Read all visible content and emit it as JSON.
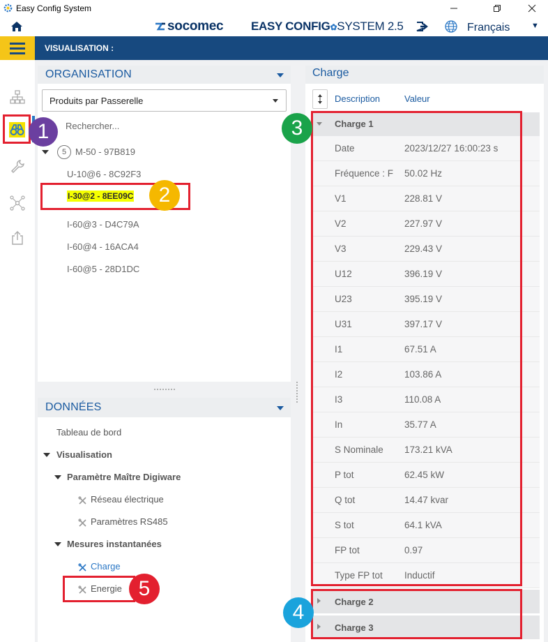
{
  "window": {
    "title": "Easy Config System"
  },
  "header": {
    "brand": "socomec",
    "product_main": "EASY CONFIG",
    "product_rest": "SYSTEM 2.5",
    "language": "Français"
  },
  "nav": {
    "title": "VISUALISATION :"
  },
  "organisation": {
    "title": "ORGANISATION",
    "select_value": "Produits par Passerelle",
    "search_placeholder": "Rechercher...",
    "root": {
      "count": "5",
      "label": "M-50 - 97B819"
    },
    "items": [
      "U-10@6 - 8C92F3",
      "I-30@2 - 8EE09C",
      "I-60@3 - D4C79A",
      "I-60@4 - 16ACA4",
      "I-60@5 - 28D1DC"
    ]
  },
  "donnees": {
    "title": "DONNÉES",
    "items": {
      "dashboard": "Tableau de bord",
      "visualisation": "Visualisation",
      "param_master": "Paramètre Maître Digiware",
      "reseau": "Réseau électrique",
      "rs485": "Paramètres RS485",
      "mesures": "Mesures instantanées",
      "charge": "Charge",
      "energie": "Energie"
    }
  },
  "charge_panel": {
    "title": "Charge",
    "columns": {
      "description": "Description",
      "value": "Valeur"
    },
    "groups": [
      "Charge 1",
      "Charge 2",
      "Charge 3"
    ],
    "rows": [
      {
        "k": "Date",
        "v": "2023/12/27 16:00:23 s"
      },
      {
        "k": "Fréquence : F",
        "v": "50.02 Hz"
      },
      {
        "k": "V1",
        "v": "228.81 V"
      },
      {
        "k": "V2",
        "v": "227.97 V"
      },
      {
        "k": "V3",
        "v": "229.43 V"
      },
      {
        "k": "U12",
        "v": "396.19 V"
      },
      {
        "k": "U23",
        "v": "395.19 V"
      },
      {
        "k": "U31",
        "v": "397.17 V"
      },
      {
        "k": "I1",
        "v": "67.51 A"
      },
      {
        "k": "I2",
        "v": "103.86 A"
      },
      {
        "k": "I3",
        "v": "110.08 A"
      },
      {
        "k": "In",
        "v": "35.77 A"
      },
      {
        "k": "S Nominale",
        "v": "173.21 kVA"
      },
      {
        "k": "P tot",
        "v": "62.45 kW"
      },
      {
        "k": "Q tot",
        "v": "14.47 kvar"
      },
      {
        "k": "S tot",
        "v": "64.1 kVA"
      },
      {
        "k": "FP tot",
        "v": "0.97"
      },
      {
        "k": "Type FP tot",
        "v": "Inductif"
      }
    ]
  },
  "markers": [
    {
      "n": "1",
      "color": "#6b3fa0"
    },
    {
      "n": "2",
      "color": "#f5b800"
    },
    {
      "n": "3",
      "color": "#1aa34a"
    },
    {
      "n": "4",
      "color": "#1aa3dc"
    },
    {
      "n": "5",
      "color": "#e3202f"
    }
  ],
  "colors": {
    "navbar": "#17497f",
    "accent": "#f5c518",
    "highlight": "#f5ff00",
    "annotation_red": "#e3202f",
    "link": "#2a77c5"
  }
}
